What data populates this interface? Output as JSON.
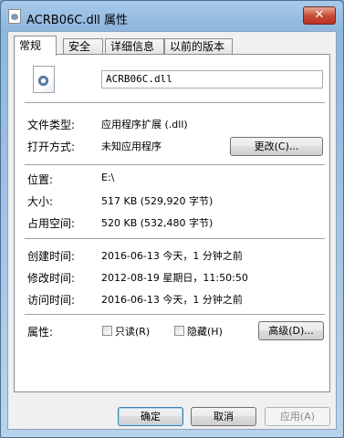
{
  "window": {
    "title": "ACRB06C.dll 属性",
    "close_label": "✕"
  },
  "tabs": [
    {
      "label": "常规",
      "active": true
    },
    {
      "label": "安全",
      "active": false
    },
    {
      "label": "详细信息",
      "active": false
    },
    {
      "label": "以前的版本",
      "active": false
    }
  ],
  "general": {
    "file_icon": "dll-gear-icon",
    "file_name": "ACRB06C.dll",
    "file_type_label": "文件类型:",
    "file_type_value": "应用程序扩展 (.dll)",
    "opens_with_label": "打开方式:",
    "opens_with_value": "未知应用程序",
    "change_button": "更改(C)...",
    "location_label": "位置:",
    "location_value": "E:\\",
    "size_label": "大小:",
    "size_value": "517 KB (529,920 字节)",
    "size_on_disk_label": "占用空间:",
    "size_on_disk_value": "520 KB (532,480 字节)",
    "created_label": "创建时间:",
    "created_value": "2016-06-13 今天，1 分钟之前",
    "modified_label": "修改时间:",
    "modified_value": "2012-08-19 星期日，11:50:50",
    "accessed_label": "访问时间:",
    "accessed_value": "2016-06-13 今天，1 分钟之前",
    "attributes_label": "属性:",
    "readonly_label": "只读(R)",
    "hidden_label": "隐藏(H)",
    "advanced_button": "高级(D)..."
  },
  "footer": {
    "ok": "确定",
    "cancel": "取消",
    "apply": "应用(A)"
  }
}
